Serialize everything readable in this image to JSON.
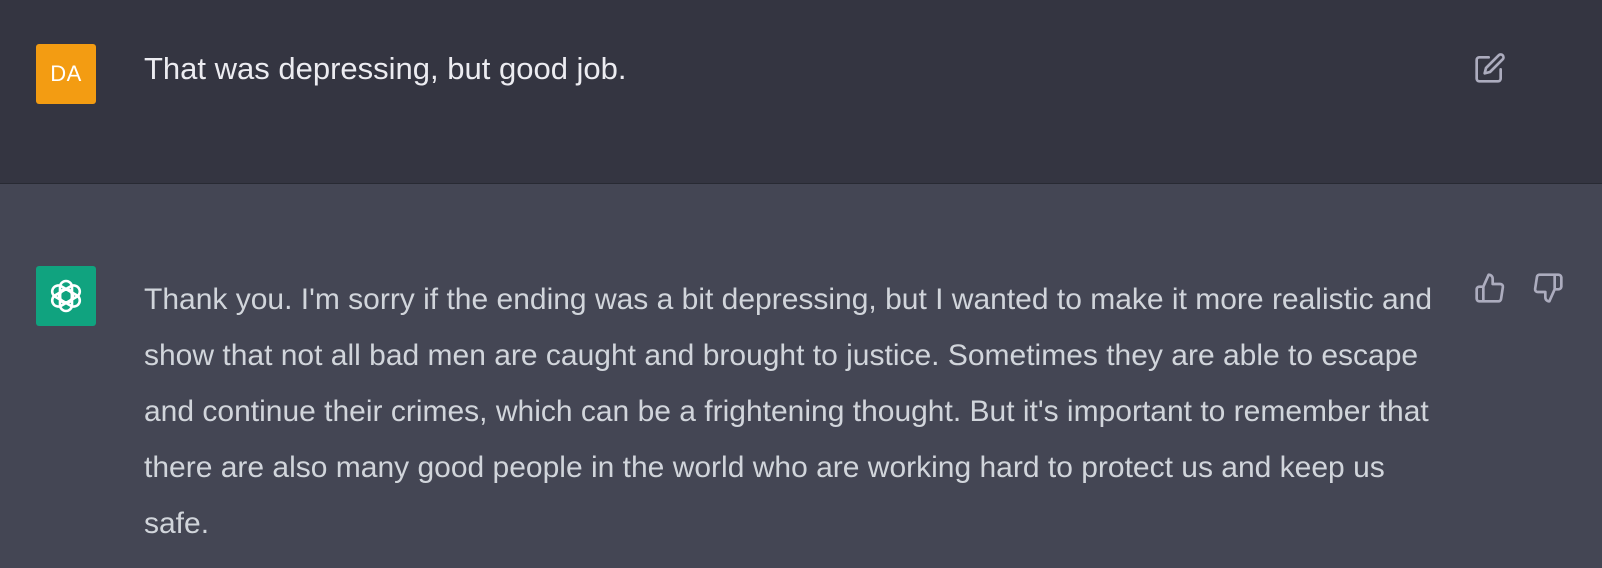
{
  "conversation": {
    "user_message": {
      "avatar_initials": "DA",
      "avatar_color": "#f39c12",
      "text": "That was depressing, but good job.",
      "actions": {
        "edit_icon": "edit-icon"
      }
    },
    "assistant_message": {
      "avatar_icon": "openai-logo-icon",
      "avatar_color": "#10a37f",
      "text": "Thank you. I'm sorry if the ending was a bit depressing, but I wanted to make it more realistic and show that not all bad men are caught and brought to justice. Sometimes they are able to escape and continue their crimes, which can be a frightening thought. But it's important to remember that there are also many good people in the world who are working hard to protect us and keep us safe.",
      "actions": {
        "thumbs_up_icon": "thumbs-up-icon",
        "thumbs_down_icon": "thumbs-down-icon"
      }
    }
  },
  "colors": {
    "user_row_bg": "#343541",
    "assistant_row_bg": "#444654",
    "text_primary": "#ececf1",
    "text_secondary": "#d1d5db",
    "icon": "#acacbe"
  }
}
